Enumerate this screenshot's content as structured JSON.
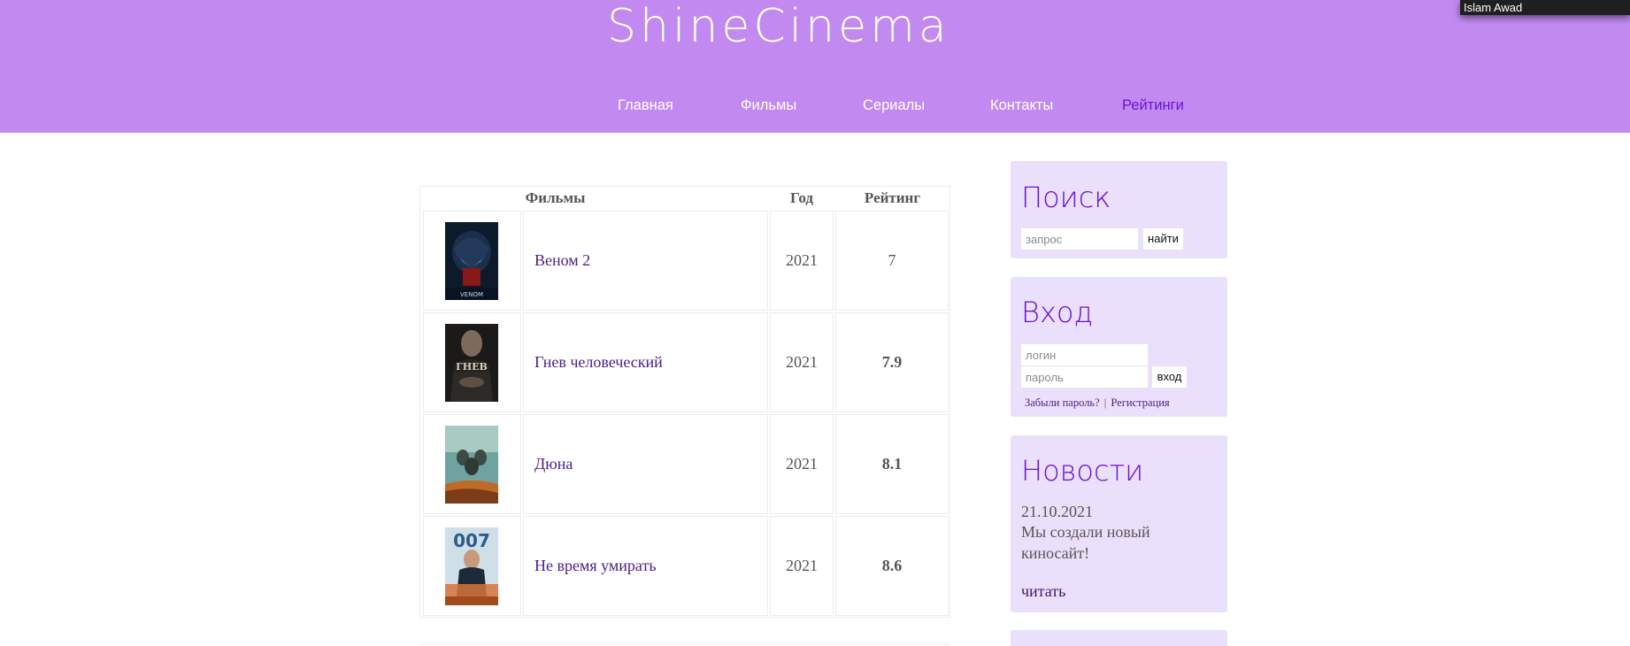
{
  "site": {
    "logo": "ShineCinema",
    "user": "Islam Awad"
  },
  "nav": {
    "items": [
      {
        "label": "Главная"
      },
      {
        "label": "Фильмы"
      },
      {
        "label": "Сериалы"
      },
      {
        "label": "Контакты"
      },
      {
        "label": "Рейтинги"
      }
    ],
    "active_color": "#6a12d3"
  },
  "table": {
    "headers": {
      "films": "Фильмы",
      "year": "Год",
      "rating": "Рейтинг"
    },
    "rows": [
      {
        "title": "Веном 2",
        "year": "2021",
        "rating": "7",
        "poster_icon": "venom-poster"
      },
      {
        "title": "Гнев человеческий",
        "year": "2021",
        "rating": "7.9",
        "poster_icon": "wrath-poster"
      },
      {
        "title": "Дюна",
        "year": "2021",
        "rating": "8.1",
        "poster_icon": "dune-poster"
      },
      {
        "title": "Не время умирать",
        "year": "2021",
        "rating": "8.6",
        "poster_icon": "bond-poster"
      }
    ]
  },
  "search": {
    "title": "Поиск",
    "placeholder": "запрос",
    "button": "найти"
  },
  "login": {
    "title": "Вход",
    "login_placeholder": "логин",
    "password_placeholder": "пароль",
    "button": "вход",
    "forgot": "Забыли пароль?",
    "separator": "|",
    "register": "Регистрация"
  },
  "news": {
    "title": "Новости",
    "date": "21.10.2021",
    "text": "Мы создали новый киносайт!",
    "read_more": "читать"
  },
  "colors": {
    "header_bg": "#c28af1",
    "panel_bg": "#ebe0fb",
    "accent": "#6a12d3",
    "link": "#4b1c86"
  }
}
